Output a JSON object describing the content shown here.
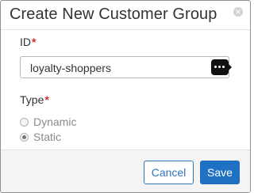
{
  "dialog": {
    "title": "Create New Customer Group",
    "close_icon": "close-icon"
  },
  "form": {
    "id_label": "ID",
    "id_required_mark": "*",
    "id_value": "loyalty-shoppers",
    "id_field_icon": "password-manager-key-icon",
    "type_label": "Type",
    "type_required_mark": "*",
    "type_options": [
      {
        "label": "Dynamic",
        "selected": false
      },
      {
        "label": "Static",
        "selected": true
      }
    ]
  },
  "footer": {
    "cancel_label": "Cancel",
    "save_label": "Save"
  },
  "colors": {
    "accent": "#1f72c3",
    "required": "#d12f2f",
    "footer_bg": "#f4f4f4"
  }
}
